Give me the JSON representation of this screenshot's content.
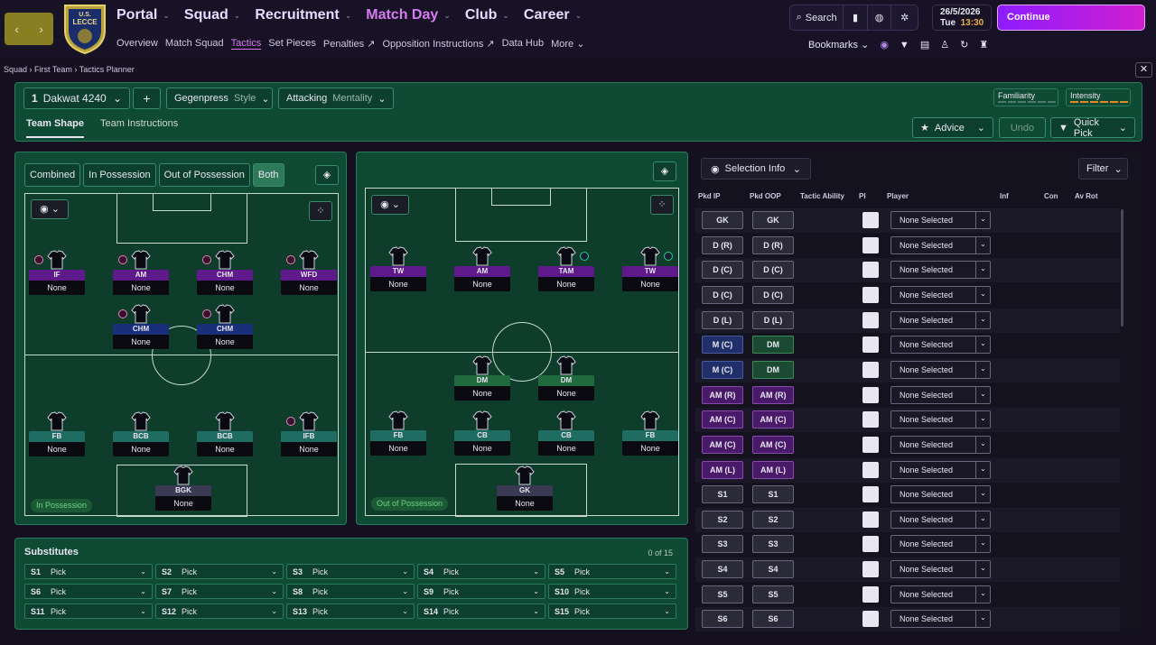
{
  "nav": {
    "items": [
      {
        "label": "Portal",
        "active": false
      },
      {
        "label": "Squad",
        "active": false
      },
      {
        "label": "Recruitment",
        "active": false
      },
      {
        "label": "Match Day",
        "active": true
      },
      {
        "label": "Club",
        "active": false
      },
      {
        "label": "Career",
        "active": false
      }
    ],
    "sub": [
      "Overview",
      "Match Squad",
      "Tactics",
      "Set Pieces",
      "Penalties",
      "Opposition Instructions",
      "Data Hub",
      "More"
    ],
    "search_label": "Search",
    "date": "26/5/2026",
    "day": "Tue",
    "time": "13:30",
    "continue_label": "Continue",
    "bookmarks_label": "Bookmarks",
    "crest_text": "U.S. LECCE"
  },
  "breadcrumb": [
    "Squad",
    "First Team",
    "Tactics Planner"
  ],
  "toolbar": {
    "tactic_number": "1",
    "tactic_name": "Dakwat 4240",
    "style_value": "Gegenpress",
    "style_label": "Style",
    "mentality_value": "Attacking",
    "mentality_label": "Mentality",
    "familiarity_label": "Familiarity",
    "intensity_label": "Intensity",
    "tab_shape": "Team Shape",
    "tab_instructions": "Team Instructions",
    "advice_label": "Advice",
    "undo_label": "Undo",
    "quickpick_label": "Quick Pick",
    "add_label": "+"
  },
  "modes": [
    "Combined",
    "In Possession",
    "Out of Possession",
    "Both"
  ],
  "in_possession": {
    "badge": "In Possession",
    "players": [
      {
        "role": "IF",
        "name": "None",
        "color": "purple"
      },
      {
        "role": "AM",
        "name": "None",
        "color": "purple"
      },
      {
        "role": "CHM",
        "name": "None",
        "color": "purple"
      },
      {
        "role": "WFD",
        "name": "None",
        "color": "purple"
      },
      {
        "role": "CHM",
        "name": "None",
        "color": "blue"
      },
      {
        "role": "CHM",
        "name": "None",
        "color": "blue"
      },
      {
        "role": "FB",
        "name": "None",
        "color": "teal"
      },
      {
        "role": "BCB",
        "name": "None",
        "color": "teal"
      },
      {
        "role": "BCB",
        "name": "None",
        "color": "teal"
      },
      {
        "role": "IFB",
        "name": "None",
        "color": "teal"
      },
      {
        "role": "BGK",
        "name": "None",
        "color": "grey"
      }
    ]
  },
  "out_of_possession": {
    "badge": "Out of Possession",
    "players": [
      {
        "role": "TW",
        "name": "None",
        "color": "purple"
      },
      {
        "role": "AM",
        "name": "None",
        "color": "purple"
      },
      {
        "role": "TAM",
        "name": "None",
        "color": "purple"
      },
      {
        "role": "TW",
        "name": "None",
        "color": "purple"
      },
      {
        "role": "DM",
        "name": "None",
        "color": "green"
      },
      {
        "role": "DM",
        "name": "None",
        "color": "green"
      },
      {
        "role": "FB",
        "name": "None",
        "color": "teal"
      },
      {
        "role": "CB",
        "name": "None",
        "color": "teal"
      },
      {
        "role": "CB",
        "name": "None",
        "color": "teal"
      },
      {
        "role": "FB",
        "name": "None",
        "color": "teal"
      },
      {
        "role": "GK",
        "name": "None",
        "color": "grey"
      }
    ]
  },
  "substitutes": {
    "title": "Substitutes",
    "count": "0 of 15",
    "slots": [
      "S1",
      "S2",
      "S3",
      "S4",
      "S5",
      "S6",
      "S7",
      "S8",
      "S9",
      "S10",
      "S11",
      "S12",
      "S13",
      "S14",
      "S15"
    ],
    "pick_label": "Pick"
  },
  "selection": {
    "info_label": "Selection Info",
    "filter_label": "Filter",
    "columns": [
      "Pkd IP",
      "Pkd OOP",
      "Tactic Ability",
      "PI",
      "Player",
      "Inf",
      "Con",
      "Av Rot"
    ],
    "none_selected": "None Selected",
    "rows": [
      {
        "ip": "GK",
        "oop": "GK",
        "ipc": "",
        "oopc": ""
      },
      {
        "ip": "D (R)",
        "oop": "D (R)",
        "ipc": "",
        "oopc": ""
      },
      {
        "ip": "D (C)",
        "oop": "D (C)",
        "ipc": "",
        "oopc": ""
      },
      {
        "ip": "D (C)",
        "oop": "D (C)",
        "ipc": "",
        "oopc": ""
      },
      {
        "ip": "D (L)",
        "oop": "D (L)",
        "ipc": "",
        "oopc": ""
      },
      {
        "ip": "M (C)",
        "oop": "DM",
        "ipc": "b",
        "oopc": "g"
      },
      {
        "ip": "M (C)",
        "oop": "DM",
        "ipc": "b",
        "oopc": "g"
      },
      {
        "ip": "AM (R)",
        "oop": "AM (R)",
        "ipc": "p",
        "oopc": "p"
      },
      {
        "ip": "AM (C)",
        "oop": "AM (C)",
        "ipc": "p",
        "oopc": "p"
      },
      {
        "ip": "AM (C)",
        "oop": "AM (C)",
        "ipc": "p",
        "oopc": "p"
      },
      {
        "ip": "AM (L)",
        "oop": "AM (L)",
        "ipc": "p",
        "oopc": "p"
      },
      {
        "ip": "S1",
        "oop": "S1",
        "ipc": "",
        "oopc": ""
      },
      {
        "ip": "S2",
        "oop": "S2",
        "ipc": "",
        "oopc": ""
      },
      {
        "ip": "S3",
        "oop": "S3",
        "ipc": "",
        "oopc": ""
      },
      {
        "ip": "S4",
        "oop": "S4",
        "ipc": "",
        "oopc": ""
      },
      {
        "ip": "S5",
        "oop": "S5",
        "ipc": "",
        "oopc": ""
      },
      {
        "ip": "S6",
        "oop": "S6",
        "ipc": "",
        "oopc": ""
      }
    ]
  },
  "colors": {
    "accent": "#d67cf0",
    "panel": "#0f4a35",
    "continue_start": "#8d1cff",
    "continue_end": "#d11ecf"
  }
}
